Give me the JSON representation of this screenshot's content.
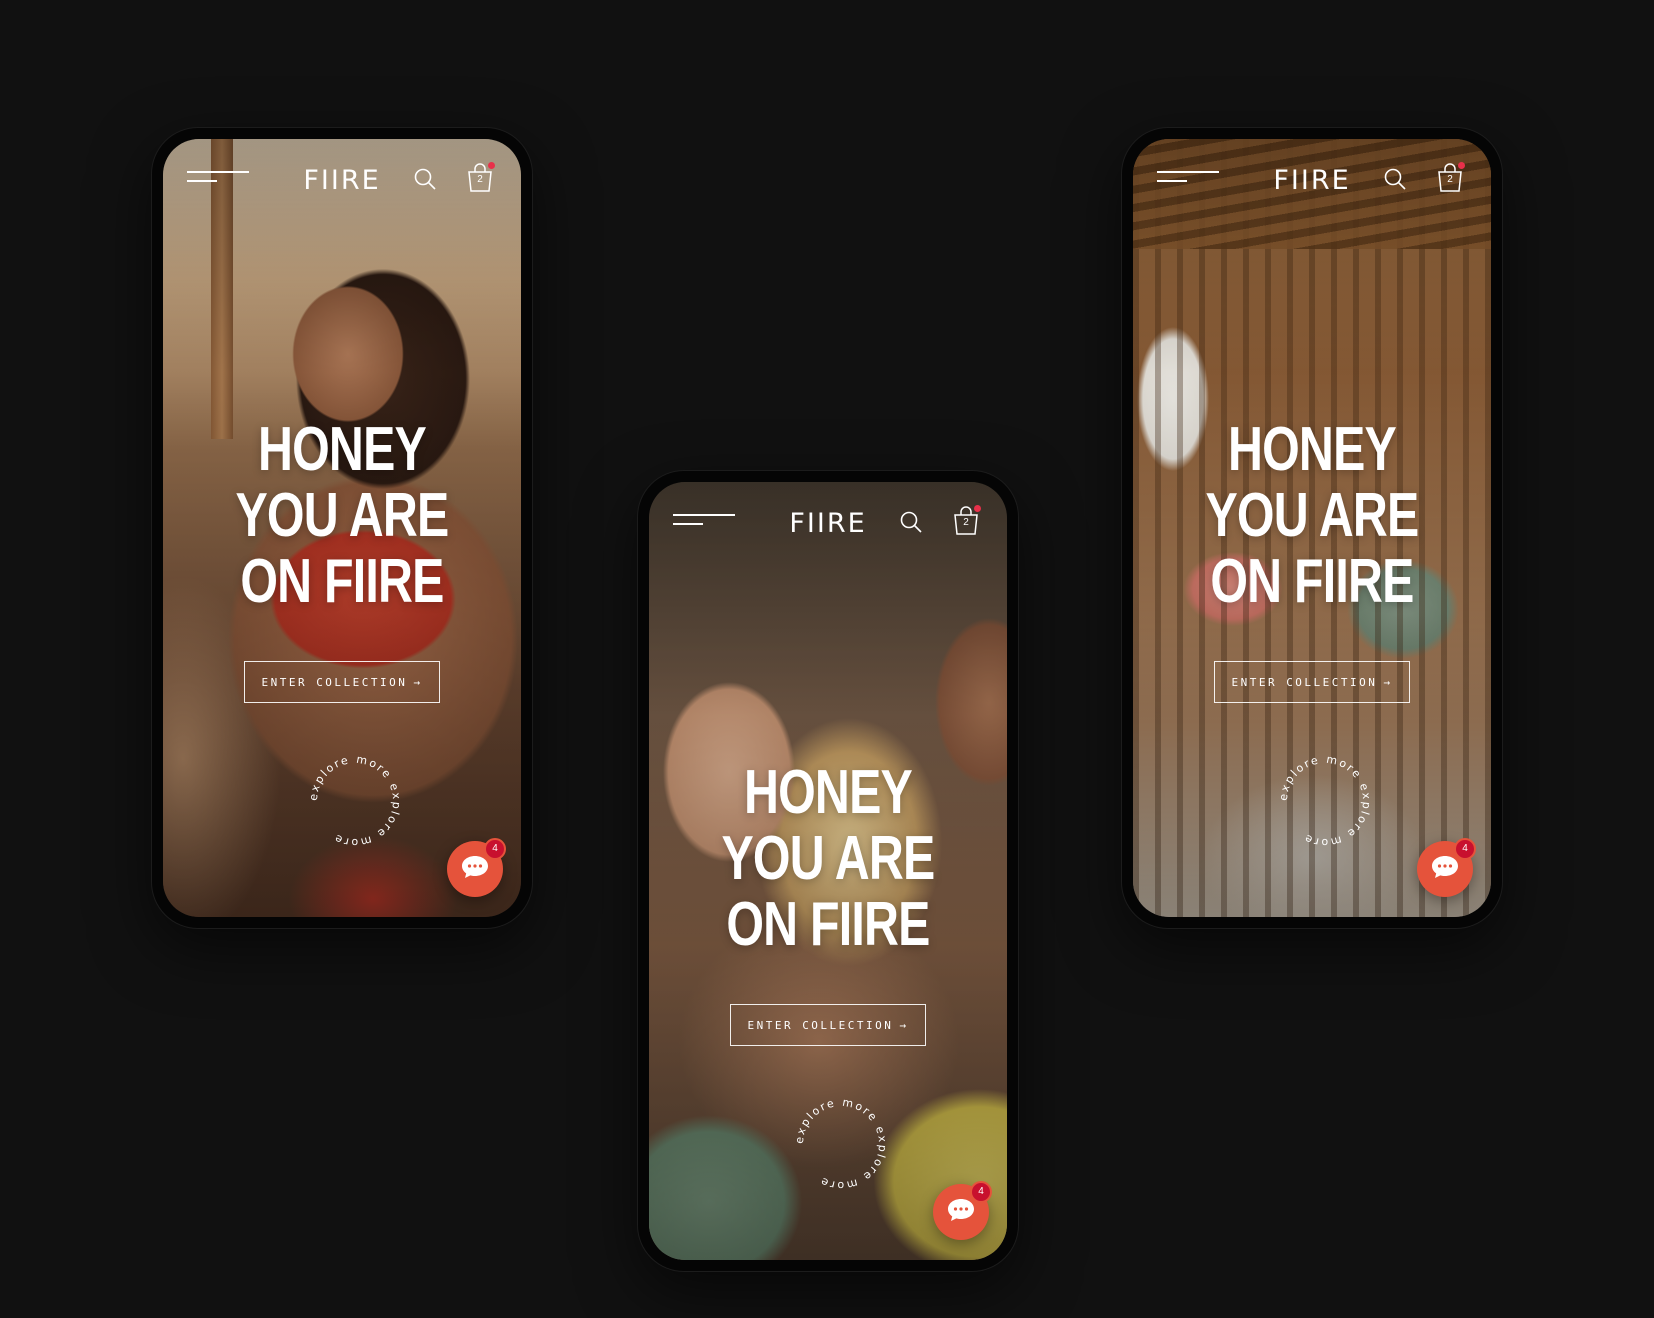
{
  "phones": [
    {
      "brand": "FIIRE",
      "cart_count": "2",
      "headline": [
        "HONEY",
        "YOU ARE",
        "ON FIIRE"
      ],
      "cta_label": "ENTER COLLECTION",
      "cta_arrow": "→",
      "explore_text": "explore more explore more ",
      "chat_badge": "4"
    },
    {
      "brand": "FIIRE",
      "cart_count": "2",
      "headline": [
        "HONEY",
        "YOU ARE",
        "ON FIIRE"
      ],
      "cta_label": "ENTER COLLECTION",
      "cta_arrow": "→",
      "explore_text": "explore more explore more ",
      "chat_badge": "4"
    },
    {
      "brand": "FIIRE",
      "cart_count": "2",
      "headline": [
        "HONEY",
        "YOU ARE",
        "ON FIIRE"
      ],
      "cta_label": "ENTER COLLECTION",
      "cta_arrow": "→",
      "explore_text": "explore more explore more ",
      "chat_badge": "4"
    }
  ],
  "icons": {
    "menu": "hamburger-icon",
    "search": "search-icon",
    "cart": "shopping-bag-icon",
    "chat": "chat-bubble-icon"
  },
  "colors": {
    "background": "#111111",
    "accent": "#e5533b",
    "badge": "#c8102e",
    "cart_dot": "#e8304a",
    "text": "#ffffff"
  }
}
